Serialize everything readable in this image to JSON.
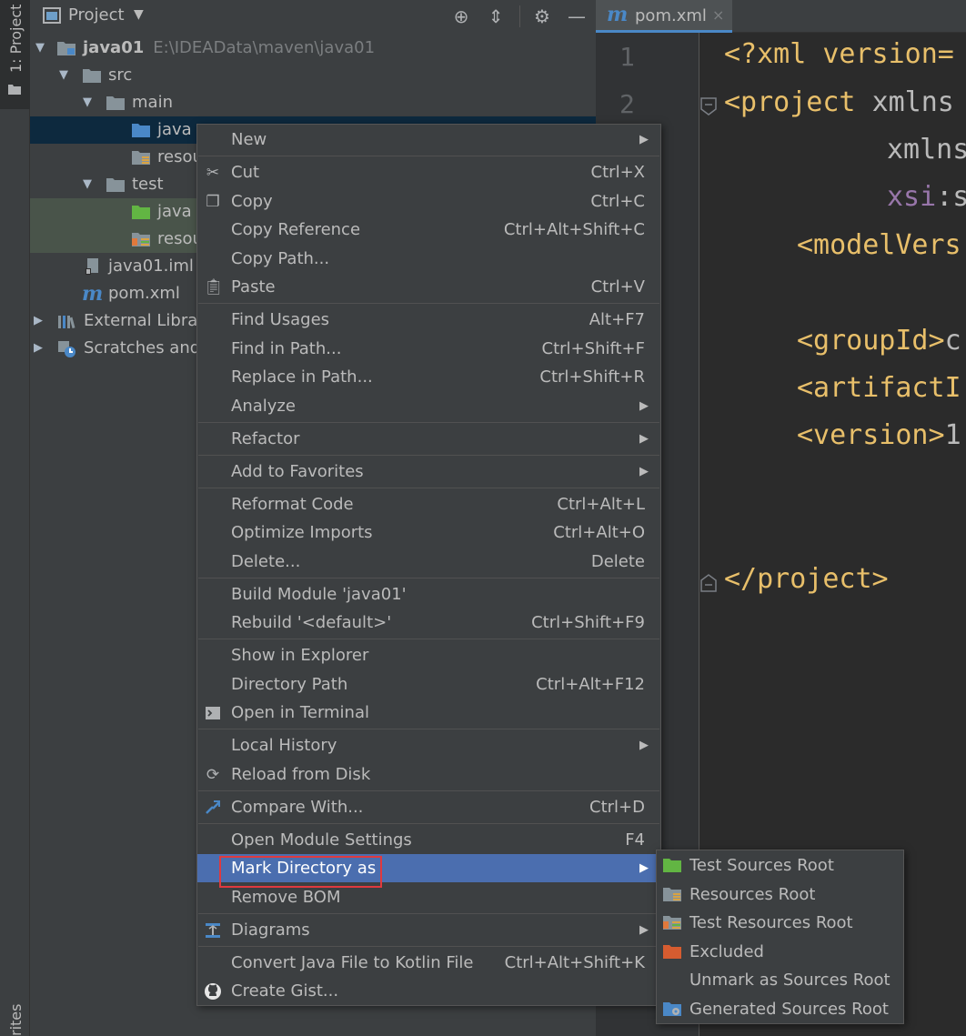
{
  "left_strip": {
    "project_tab": "1: Project",
    "bottom_tab": "rites"
  },
  "project_panel": {
    "title": "Project",
    "tree": [
      {
        "label": "java01",
        "path": "E:\\IDEAData\\maven\\java01"
      },
      {
        "label": "src"
      },
      {
        "label": "main"
      },
      {
        "label": "java"
      },
      {
        "label": "resou"
      },
      {
        "label": "test"
      },
      {
        "label": "java"
      },
      {
        "label": "resou"
      },
      {
        "label": "java01.iml"
      },
      {
        "label": "pom.xml"
      },
      {
        "label": "External Librar"
      },
      {
        "label": "Scratches and"
      }
    ]
  },
  "editor": {
    "tab": {
      "icon": "m",
      "label": "pom.xml",
      "close": "×"
    },
    "line_numbers": [
      "1",
      "2"
    ],
    "code": {
      "l1": "<?xml version=",
      "l2_open": "<project ",
      "l2_attr": "xmlns",
      "l3_attr": "xmlns",
      "l4_ns": "xsi",
      "l4_rest": ":s",
      "l5": "<modelVers",
      "l6": "<groupId>",
      "l6_rest": "c",
      "l7": "<artifactI",
      "l8": "<version>",
      "l8_rest": "1",
      "l9": "</project>"
    }
  },
  "context_menu": {
    "items": [
      {
        "label": "New",
        "submenu": true
      },
      {
        "label": "Cut",
        "shortcut": "Ctrl+X",
        "icon": "scissors-icon"
      },
      {
        "label": "Copy",
        "shortcut": "Ctrl+C",
        "icon": "copy-icon"
      },
      {
        "label": "Copy Reference",
        "shortcut": "Ctrl+Alt+Shift+C"
      },
      {
        "label": "Copy Path...",
        "shortcut": ""
      },
      {
        "label": "Paste",
        "shortcut": "Ctrl+V",
        "icon": "clipboard-icon"
      },
      {
        "label": "Find Usages",
        "shortcut": "Alt+F7"
      },
      {
        "label": "Find in Path...",
        "shortcut": "Ctrl+Shift+F"
      },
      {
        "label": "Replace in Path...",
        "shortcut": "Ctrl+Shift+R"
      },
      {
        "label": "Analyze",
        "submenu": true
      },
      {
        "label": "Refactor",
        "submenu": true
      },
      {
        "label": "Add to Favorites",
        "submenu": true
      },
      {
        "label": "Reformat Code",
        "shortcut": "Ctrl+Alt+L"
      },
      {
        "label": "Optimize Imports",
        "shortcut": "Ctrl+Alt+O"
      },
      {
        "label": "Delete...",
        "shortcut": "Delete"
      },
      {
        "label": "Build Module 'java01'",
        "shortcut": ""
      },
      {
        "label": "Rebuild '<default>'",
        "shortcut": "Ctrl+Shift+F9"
      },
      {
        "label": "Show in Explorer",
        "shortcut": ""
      },
      {
        "label": "Directory Path",
        "shortcut": "Ctrl+Alt+F12"
      },
      {
        "label": "Open in Terminal",
        "icon": "terminal-icon"
      },
      {
        "label": "Local History",
        "submenu": true
      },
      {
        "label": "Reload from Disk",
        "icon": "reload-icon"
      },
      {
        "label": "Compare With...",
        "shortcut": "Ctrl+D",
        "icon": "compare-icon"
      },
      {
        "label": "Open Module Settings",
        "shortcut": "F4"
      },
      {
        "label": "Mark Directory as",
        "submenu": true,
        "highlighted": true
      },
      {
        "label": "Remove BOM"
      },
      {
        "label": "Diagrams",
        "submenu": true,
        "icon": "diagram-icon"
      },
      {
        "label": "Convert Java File to Kotlin File",
        "shortcut": "Ctrl+Alt+Shift+K"
      },
      {
        "label": "Create Gist...",
        "icon": "github-icon"
      }
    ],
    "submenu_arrow": "▶"
  },
  "mark_directory_submenu": {
    "items": [
      {
        "label": "Test Sources Root",
        "icon": "test-sources-folder-icon"
      },
      {
        "label": "Resources Root",
        "icon": "resources-folder-icon"
      },
      {
        "label": "Test Resources Root",
        "icon": "test-resources-folder-icon"
      },
      {
        "label": "Excluded",
        "icon": "excluded-folder-icon"
      },
      {
        "label": "Unmark as Sources Root"
      },
      {
        "label": "Generated Sources Root",
        "icon": "generated-sources-folder-icon"
      }
    ]
  },
  "colors": {
    "highlight": "#4b6eaf",
    "selected_row": "#0d293e",
    "test_row": "#49544a",
    "red_box": "#e0393e",
    "xml_tag": "#e8bf6a"
  }
}
